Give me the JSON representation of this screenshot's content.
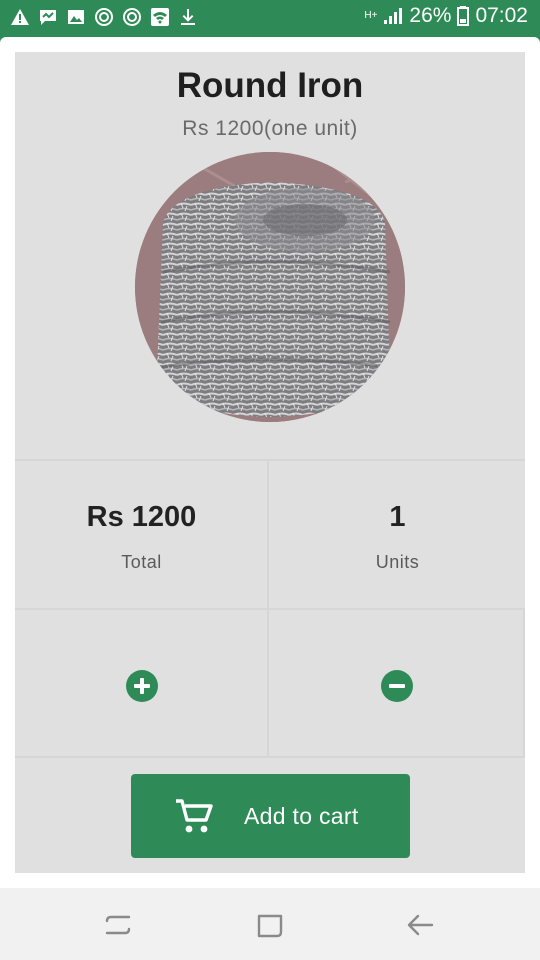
{
  "status_bar": {
    "network_type": "H+",
    "battery_percent": "26%",
    "time": "07:02",
    "left_icons": [
      "warning-icon",
      "message-icon",
      "image-icon",
      "sync-icon",
      "sync-icon",
      "wifi-icon",
      "download-icon"
    ]
  },
  "product": {
    "title": "Round Iron",
    "price_label": "Rs 1200(one unit)",
    "image": "barbed-wire-coil"
  },
  "stats": {
    "total_value": "Rs 1200",
    "total_label": "Total",
    "units_value": "1",
    "units_label": "Units"
  },
  "actions": {
    "increment_icon": "plus-circle-icon",
    "decrement_icon": "minus-circle-icon",
    "add_to_cart_label": "Add to cart"
  },
  "nav_bar": {
    "buttons": [
      "recents-icon",
      "home-icon",
      "back-icon"
    ]
  },
  "colors": {
    "accent": "#2e8b57",
    "card_bg": "#e0e0e0",
    "nav_bg": "#f1f1f1"
  }
}
